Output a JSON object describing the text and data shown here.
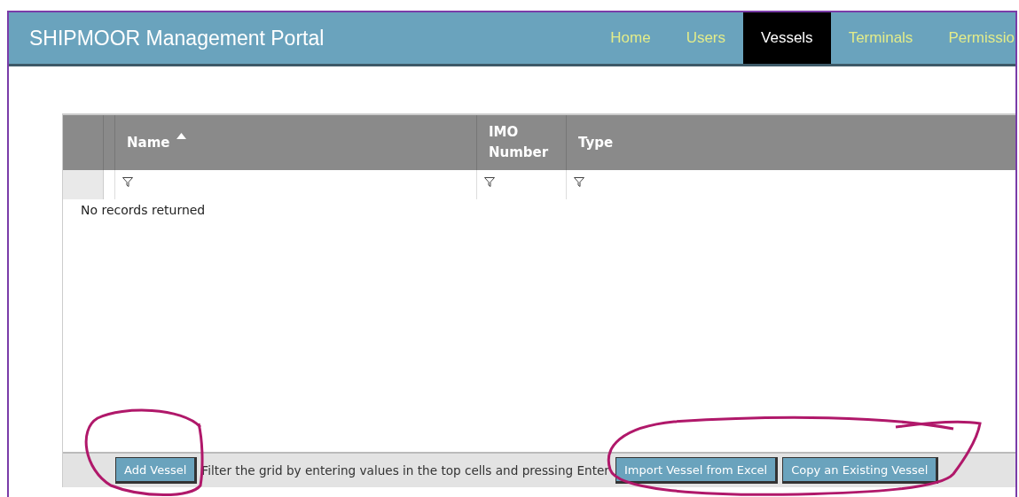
{
  "header": {
    "title": "SHIPMOOR Management Portal",
    "nav": [
      {
        "label": "Home",
        "selected": false
      },
      {
        "label": "Users",
        "selected": false
      },
      {
        "label": "Vessels",
        "selected": true
      },
      {
        "label": "Terminals",
        "selected": false
      },
      {
        "label": "Permissio",
        "selected": false
      }
    ]
  },
  "grid": {
    "columns": [
      {
        "label": "Name",
        "sorted": true
      },
      {
        "label": "IMO Number",
        "sorted": false
      },
      {
        "label": "Type",
        "sorted": false
      }
    ],
    "empty_message": "No records returned",
    "footer": {
      "left_button": "Add Vessel",
      "hint": "Filter the grid by entering values in the top cells and pressing Enter",
      "right_buttons": [
        "Import Vessel from Excel",
        "Copy an Existing Vessel"
      ]
    }
  }
}
